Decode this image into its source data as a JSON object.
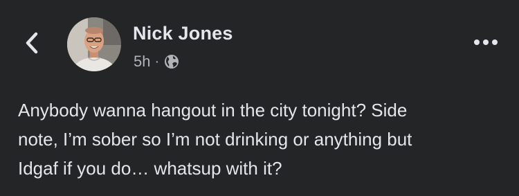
{
  "header": {
    "back_icon": "chevron-left-icon",
    "author_name": "Nick Jones",
    "timestamp": "5h",
    "separator": "·",
    "audience_icon": "globe-icon",
    "more_icon": "more-horizontal-icon",
    "avatar": "profile-photo"
  },
  "post": {
    "text": "Anybody wanna hangout in the city tonight? Side\nnote, I’m sober so I’m not drinking or anything but\nIdgaf if you do… whatsup with it?"
  },
  "colors": {
    "background": "#242526",
    "primary_text": "#e4e6eb",
    "secondary_text": "#b0b3b8"
  }
}
